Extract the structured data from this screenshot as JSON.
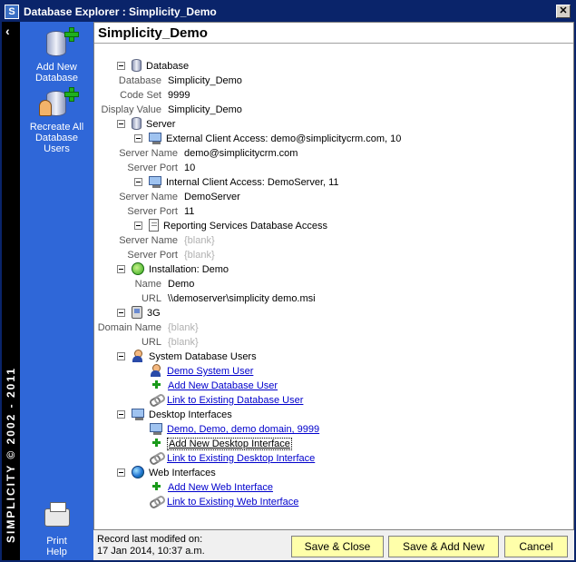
{
  "window": {
    "title": "Database Explorer : Simplicity_Demo",
    "app_icon_letter": "S",
    "close_glyph": "✕"
  },
  "leftstrip": {
    "collapse_glyph": "‹",
    "vertical_text": "SIMPLICITY © 2002 - 2011"
  },
  "sidebar": {
    "add_new_database": "Add New Database",
    "recreate_users": "Recreate All Database Users",
    "print": "Print",
    "help": "Help"
  },
  "main": {
    "title": "Simplicity_Demo",
    "database": {
      "label": "Database",
      "props": [
        {
          "label": "Database",
          "value": "Simplicity_Demo"
        },
        {
          "label": "Code Set",
          "value": "9999"
        },
        {
          "label": "Display Value",
          "value": "Simplicity_Demo"
        }
      ]
    },
    "server": {
      "label": "Server",
      "external": {
        "label": "External Client Access:  demo@simplicitycrm.com, 10",
        "server_name_label": "Server Name",
        "server_name": "demo@simplicitycrm.com",
        "server_port_label": "Server Port",
        "server_port": "10"
      },
      "internal": {
        "label": "Internal Client Access:  DemoServer, 11",
        "server_name_label": "Server Name",
        "server_name": "DemoServer",
        "server_port_label": "Server Port",
        "server_port": "11"
      },
      "reporting": {
        "label": "Reporting Services Database Access",
        "server_name_label": "Server Name",
        "server_name": "{blank}",
        "server_port_label": "Server Port",
        "server_port": "{blank}"
      }
    },
    "installation": {
      "label": "Installation:  Demo",
      "name_label": "Name",
      "name": "Demo",
      "url_label": "URL",
      "url": "\\\\demoserver\\simplicity demo.msi"
    },
    "threeg": {
      "label": "3G",
      "domain_label": "Domain Name",
      "domain": "{blank}",
      "url_label": "URL",
      "url": "{blank}"
    },
    "system_users": {
      "label": "System Database Users",
      "items": [
        "Demo System User",
        "Add New Database User",
        "Link to Existing Database User"
      ]
    },
    "desktop": {
      "label": "Desktop Interfaces",
      "items": [
        "Demo, Demo, demo domain, 9999",
        "Add New Desktop Interface",
        "Link to Existing Desktop Interface"
      ]
    },
    "web": {
      "label": "Web Interfaces",
      "items": [
        "Add New Web Interface",
        "Link to Existing Web Interface"
      ]
    }
  },
  "footer": {
    "record_label": "Record last modifed on:",
    "record_date": "17 Jan 2014, 10:37 a.m.",
    "save_close": "Save & Close",
    "save_add_new": "Save & Add New",
    "cancel": "Cancel"
  },
  "colors": {
    "titlebar": "#0a246a",
    "sidebar": "#2f67d8",
    "link": "#0000cc",
    "button": "#ffffaa"
  }
}
